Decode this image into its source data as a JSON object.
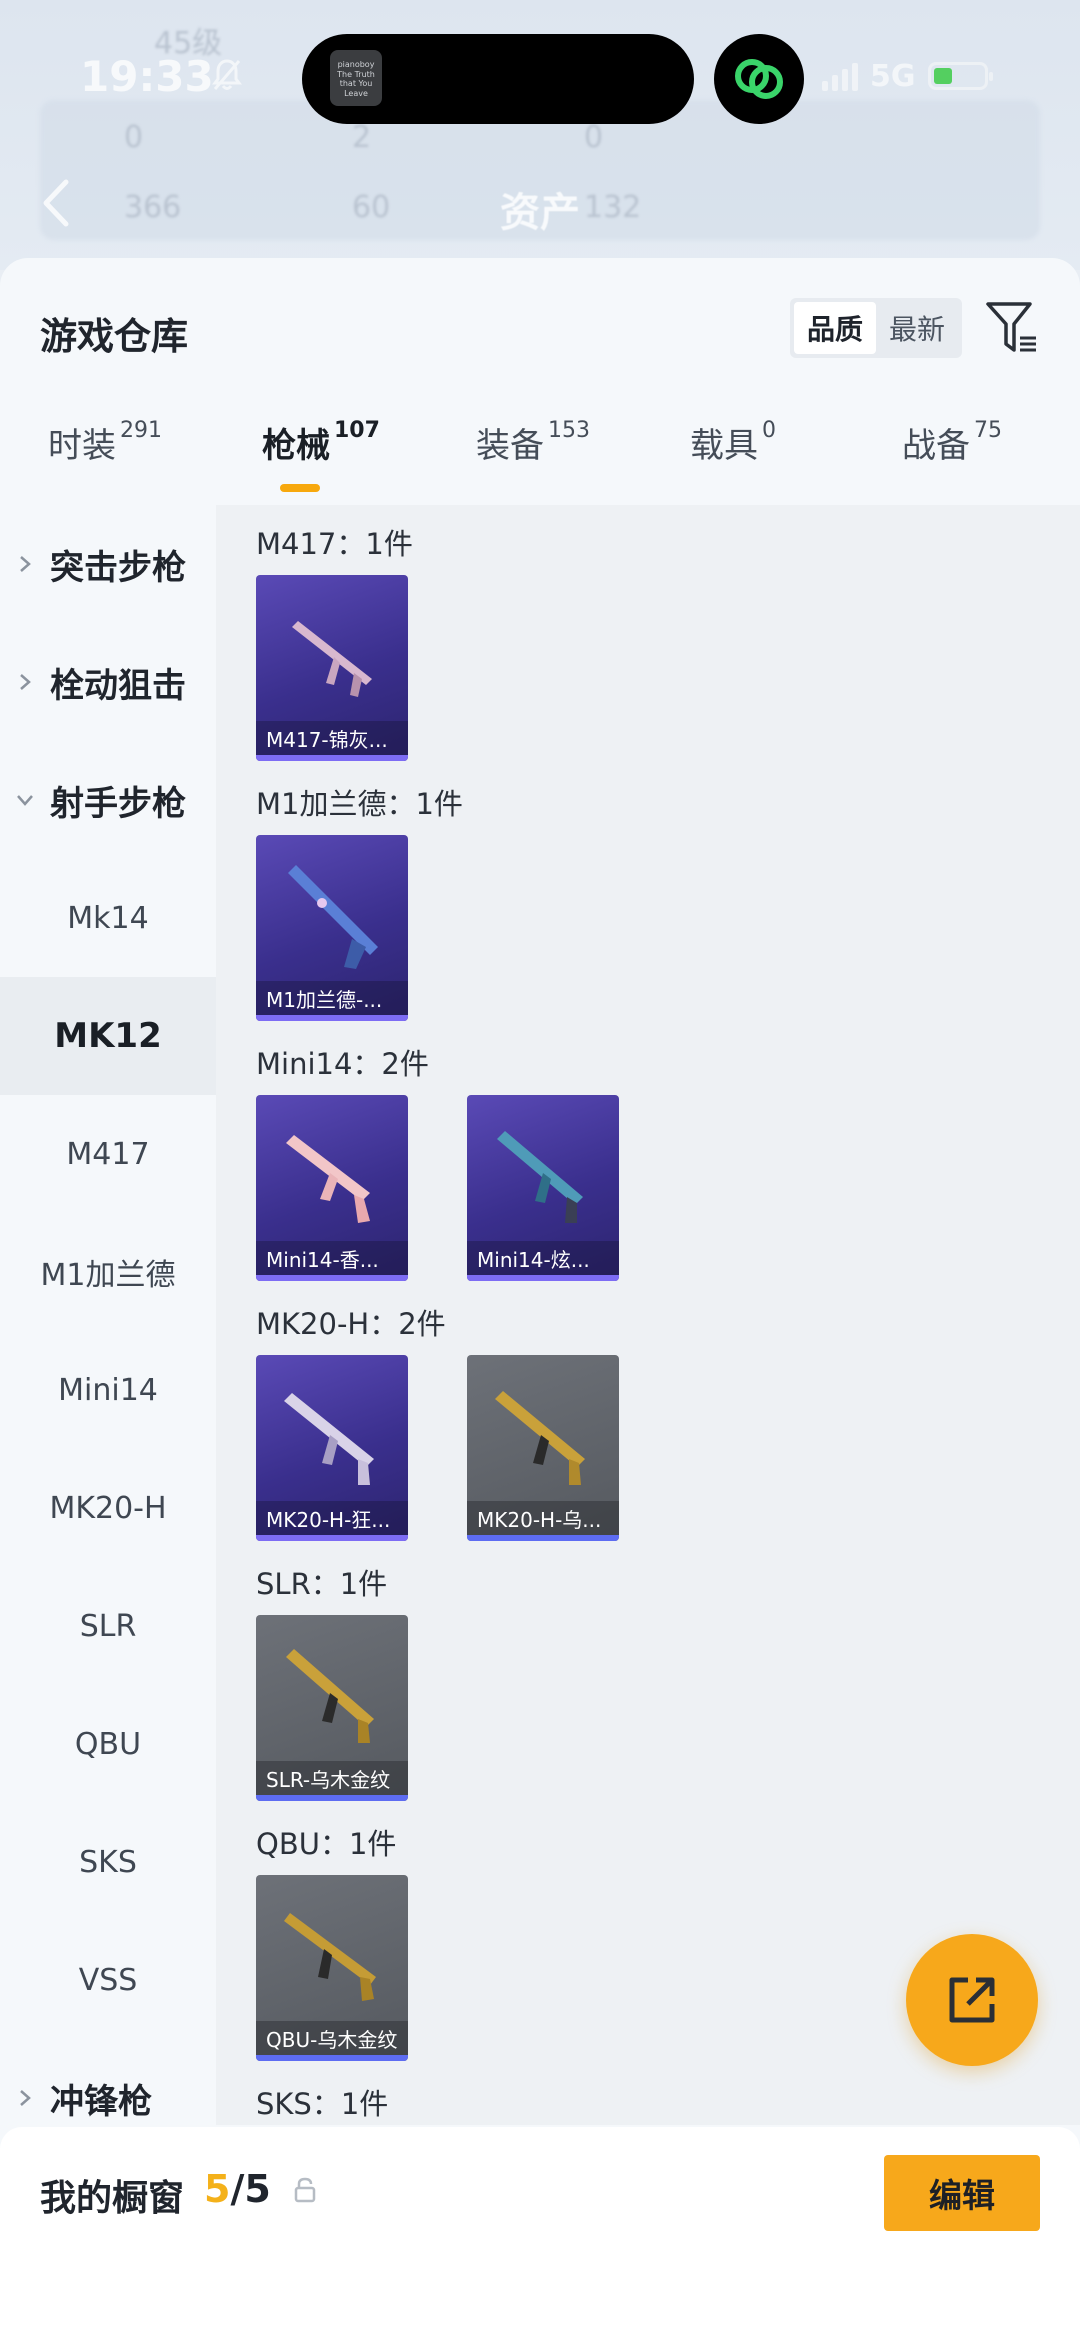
{
  "status_bar": {
    "time": "19:33",
    "network": "5G",
    "island_thumb_text": "pianoboy The Truth that You Leave"
  },
  "background": {
    "level_text": "45级",
    "counts": [
      "0",
      "2",
      "0"
    ],
    "stats": [
      "366",
      "60",
      "132"
    ],
    "assets_title": "资产"
  },
  "panel": {
    "title": "游戏仓库",
    "sort_options": [
      "品质",
      "最新"
    ],
    "sort_active": "品质"
  },
  "tabs": [
    {
      "label": "时装",
      "count": "291"
    },
    {
      "label": "枪械",
      "count": "107"
    },
    {
      "label": "装备",
      "count": "153"
    },
    {
      "label": "载具",
      "count": "0"
    },
    {
      "label": "战备",
      "count": "75"
    }
  ],
  "active_tab": "枪械",
  "sidebar": {
    "items": [
      {
        "label": "突击步枪",
        "type": "group",
        "expanded": false
      },
      {
        "label": "栓动狙击",
        "type": "group",
        "expanded": false
      },
      {
        "label": "射手步枪",
        "type": "group",
        "expanded": true
      },
      {
        "label": "Mk14",
        "type": "sub"
      },
      {
        "label": "MK12",
        "type": "sub",
        "selected": true
      },
      {
        "label": "M417",
        "type": "sub"
      },
      {
        "label": "M1加兰德",
        "type": "sub"
      },
      {
        "label": "Mini14",
        "type": "sub"
      },
      {
        "label": "MK20-H",
        "type": "sub"
      },
      {
        "label": "SLR",
        "type": "sub"
      },
      {
        "label": "QBU",
        "type": "sub"
      },
      {
        "label": "SKS",
        "type": "sub"
      },
      {
        "label": "VSS",
        "type": "sub"
      },
      {
        "label": "冲锋枪",
        "type": "group",
        "expanded": false
      }
    ]
  },
  "sections": [
    {
      "title": "M417：1件",
      "cards": [
        {
          "label": "M417-锦灰...",
          "rarity": "purple"
        }
      ]
    },
    {
      "title": "M1加兰德：1件",
      "cards": [
        {
          "label": "M1加兰德-...",
          "rarity": "purple"
        }
      ]
    },
    {
      "title": "Mini14：2件",
      "cards": [
        {
          "label": "Mini14-香...",
          "rarity": "purple"
        },
        {
          "label": "Mini14-炫...",
          "rarity": "purple"
        }
      ]
    },
    {
      "title": "MK20-H：2件",
      "cards": [
        {
          "label": "MK20-H-狂...",
          "rarity": "purple"
        },
        {
          "label": "MK20-H-乌...",
          "rarity": "grey"
        }
      ]
    },
    {
      "title": "SLR：1件",
      "cards": [
        {
          "label": "SLR-乌木金纹",
          "rarity": "grey"
        }
      ]
    },
    {
      "title": "QBU：1件",
      "cards": [
        {
          "label": "QBU-乌木金纹",
          "rarity": "grey"
        }
      ]
    },
    {
      "title": "SKS：1件",
      "cards": []
    }
  ],
  "bottom_bar": {
    "showcase_label": "我的橱窗",
    "showcase_current": "5",
    "showcase_total": "/5",
    "edit_label": "编辑"
  },
  "colors": {
    "accent": "#f7a81b",
    "purple_card": "#3a2f8d",
    "grey_card": "#55595f",
    "selected_bg": "#e9edf1"
  }
}
